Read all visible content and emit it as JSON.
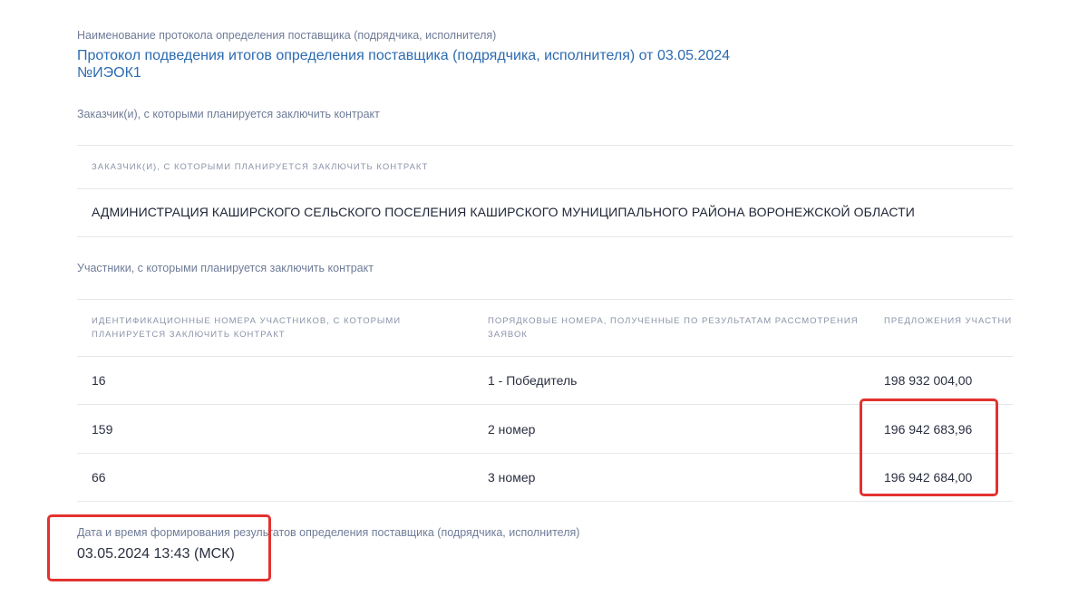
{
  "protocol": {
    "name_label": "Наименование протокола определения поставщика (подрядчика, исполнителя)",
    "title_line1": "Протокол подведения итогов определения поставщика (подрядчика, исполнителя) от 03.05.2024",
    "title_line2": "№ИЭОК1"
  },
  "customers": {
    "section_label": "Заказчик(и), с которыми планируется заключить контракт",
    "column_header": "Заказчик(и), с которыми планируется заключить контракт",
    "rows": [
      {
        "name": "АДМИНИСТРАЦИЯ КАШИРСКОГО СЕЛЬСКОГО ПОСЕЛЕНИЯ КАШИРСКОГО МУНИЦИПАЛЬНОГО РАЙОНА ВОРОНЕЖСКОЙ ОБЛАСТИ"
      }
    ]
  },
  "participants": {
    "section_label": "Участники, с которыми планируется заключить контракт",
    "columns": [
      "Идентификационные номера участников, с которыми планируется заключить контракт",
      "Порядковые номера, полученные по результатам рассмотрения заявок",
      "Предложения участни"
    ],
    "rows": [
      {
        "id": "16",
        "rank": "1 - Победитель",
        "offer": "198 932 004,00"
      },
      {
        "id": "159",
        "rank": "2 номер",
        "offer": "196 942 683,96"
      },
      {
        "id": "66",
        "rank": "3 номер",
        "offer": "196 942 684,00"
      }
    ]
  },
  "result_datetime": {
    "label": "Дата и время формирования результатов определения поставщика (подрядчика, исполнителя)",
    "value": "03.05.2024 13:43 (МСК)"
  },
  "colors": {
    "link": "#2d6bb1",
    "label": "#6f7c98",
    "highlight": "#e3322f",
    "divider": "#e4e7ec"
  }
}
